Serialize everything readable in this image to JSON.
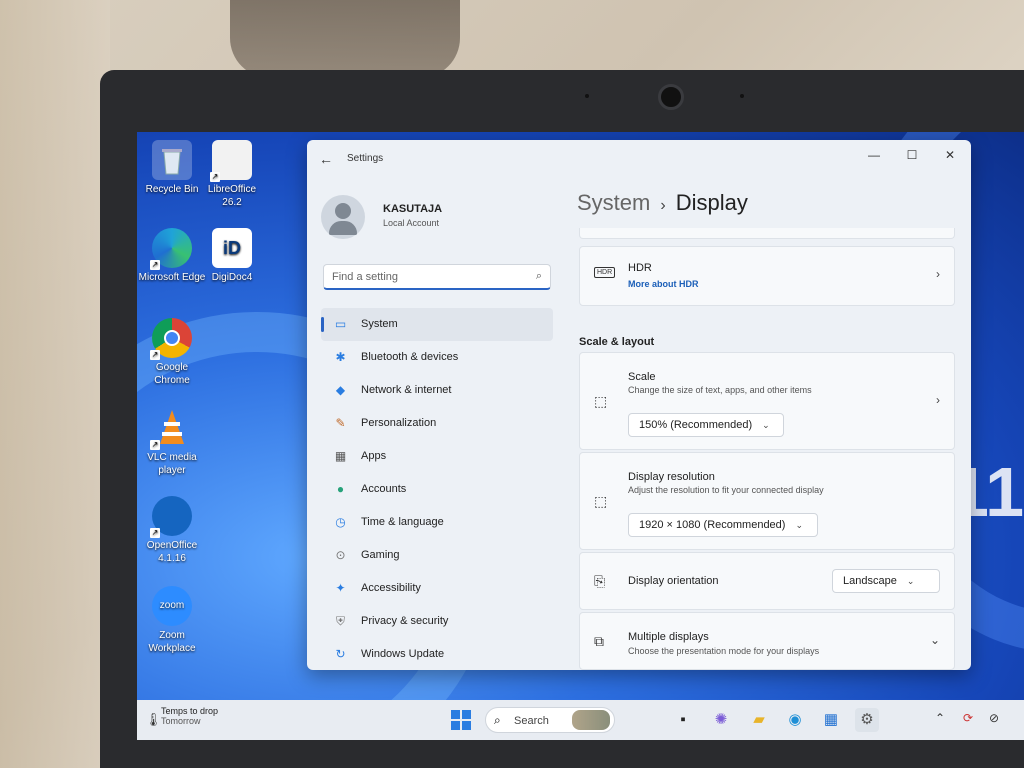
{
  "desktop": {
    "icons": [
      {
        "label": "Recycle Bin",
        "icon": "recycle-bin-icon"
      },
      {
        "label": "LibreOffice 26.2",
        "icon": "libreoffice-icon"
      },
      {
        "label": "Microsoft Edge",
        "icon": "edge-icon"
      },
      {
        "label": "DigiDoc4",
        "icon": "digidoc-icon",
        "badge": "iD"
      },
      {
        "label": "Google Chrome",
        "icon": "chrome-icon"
      },
      {
        "label": "VLC media player",
        "icon": "vlc-icon"
      },
      {
        "label": "OpenOffice 4.1.16",
        "icon": "openoffice-icon"
      },
      {
        "label": "Zoom Workplace",
        "icon": "zoom-icon",
        "badge": "zoom"
      }
    ],
    "wallpaper_text": "11"
  },
  "window": {
    "title": "Settings",
    "back": "←",
    "minimize": "—",
    "maximize": "☐",
    "close": "✕"
  },
  "account": {
    "name": "KASUTAJA",
    "type": "Local Account"
  },
  "search": {
    "placeholder": "Find a setting",
    "icon": "⌕"
  },
  "nav": [
    {
      "label": "System",
      "icon": "system-icon",
      "glyph": "▭",
      "color": "#2a7de1",
      "active": true
    },
    {
      "label": "Bluetooth & devices",
      "icon": "bluetooth-icon",
      "glyph": "✱",
      "color": "#2a7de1"
    },
    {
      "label": "Network & internet",
      "icon": "network-icon",
      "glyph": "◆",
      "color": "#2a7de1"
    },
    {
      "label": "Personalization",
      "icon": "brush-icon",
      "glyph": "✎",
      "color": "#c06a2b"
    },
    {
      "label": "Apps",
      "icon": "apps-icon",
      "glyph": "▦",
      "color": "#555"
    },
    {
      "label": "Accounts",
      "icon": "accounts-icon",
      "glyph": "●",
      "color": "#27a27a"
    },
    {
      "label": "Time & language",
      "icon": "time-language-icon",
      "glyph": "◷",
      "color": "#2a7de1"
    },
    {
      "label": "Gaming",
      "icon": "gaming-icon",
      "glyph": "⊙",
      "color": "#777"
    },
    {
      "label": "Accessibility",
      "icon": "accessibility-icon",
      "glyph": "✦",
      "color": "#2a7de1"
    },
    {
      "label": "Privacy & security",
      "icon": "shield-icon",
      "glyph": "⛨",
      "color": "#777"
    },
    {
      "label": "Windows Update",
      "icon": "update-icon",
      "glyph": "↻",
      "color": "#2a7de1"
    }
  ],
  "breadcrumb": {
    "parent": "System",
    "separator": "›",
    "current": "Display"
  },
  "hdr": {
    "title": "HDR",
    "link": "More about HDR",
    "icon_text": "HDR"
  },
  "section_scale_layout": "Scale & layout",
  "scale": {
    "title": "Scale",
    "subtitle": "Change the size of text, apps, and other items",
    "value": "150% (Recommended)"
  },
  "resolution": {
    "title": "Display resolution",
    "subtitle": "Adjust the resolution to fit your connected display",
    "value": "1920 × 1080 (Recommended)"
  },
  "orientation": {
    "title": "Display orientation",
    "value": "Landscape"
  },
  "multiple_displays": {
    "title": "Multiple displays",
    "subtitle": "Choose the presentation mode for your displays"
  },
  "taskbar": {
    "weather_title": "Temps to drop",
    "weather_sub": "Tomorrow",
    "search_label": "Search",
    "apps": [
      "task-view-icon",
      "copilot-icon",
      "file-explorer-icon",
      "edge-icon",
      "store-icon",
      "settings-icon"
    ],
    "tray": [
      "chevron-up-icon",
      "sync-icon",
      "network-off-icon"
    ]
  }
}
